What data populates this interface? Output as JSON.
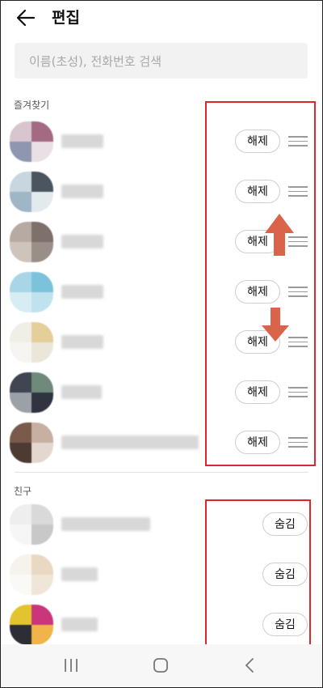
{
  "header": {
    "title": "편집"
  },
  "search": {
    "placeholder": "이름(초성), 전화번호 검색"
  },
  "favorites": {
    "label": "즐겨찾기",
    "button_label": "해제",
    "rows": [
      {
        "avatar_colors": [
          "#d7c6cf",
          "#a46a83",
          "#8e96b0",
          "#e9dfe4"
        ]
      },
      {
        "avatar_colors": [
          "#c7d6df",
          "#4a5560",
          "#9fb6c6",
          "#e3eaee"
        ]
      },
      {
        "avatar_colors": [
          "#b7aaa2",
          "#7e706a",
          "#cfc4bc",
          "#9a8e88"
        ]
      },
      {
        "avatar_colors": [
          "#a8d6e6",
          "#7cc2db",
          "#d8edf3",
          "#bfe2ee"
        ]
      },
      {
        "avatar_colors": [
          "#f1eee6",
          "#e4cf9a",
          "#f7f5f1",
          "#ebe6da"
        ]
      },
      {
        "avatar_colors": [
          "#3f4652",
          "#6f8a7a",
          "#9aa2a8",
          "#2f3440"
        ]
      },
      {
        "avatar_colors": [
          "#7a5a4a",
          "#c7b0a2",
          "#4d3a32",
          "#e4d7cf"
        ]
      }
    ]
  },
  "friends": {
    "label": "친구",
    "button_label": "숨김",
    "rows": [
      {
        "avatar_colors": [
          "#eeeeee",
          "#d9d9d9",
          "#f6f6f6",
          "#c8c8c8"
        ]
      },
      {
        "avatar_colors": [
          "#f6f2ec",
          "#ead9c2",
          "#fbf9f6",
          "#f0e6d8"
        ]
      },
      {
        "avatar_colors": [
          "#e4c330",
          "#c9367a",
          "#2c2d35",
          "#f0b44a"
        ]
      }
    ]
  },
  "colors": {
    "accent_red": "#e0262d",
    "arrow_orange": "#d9644a"
  }
}
